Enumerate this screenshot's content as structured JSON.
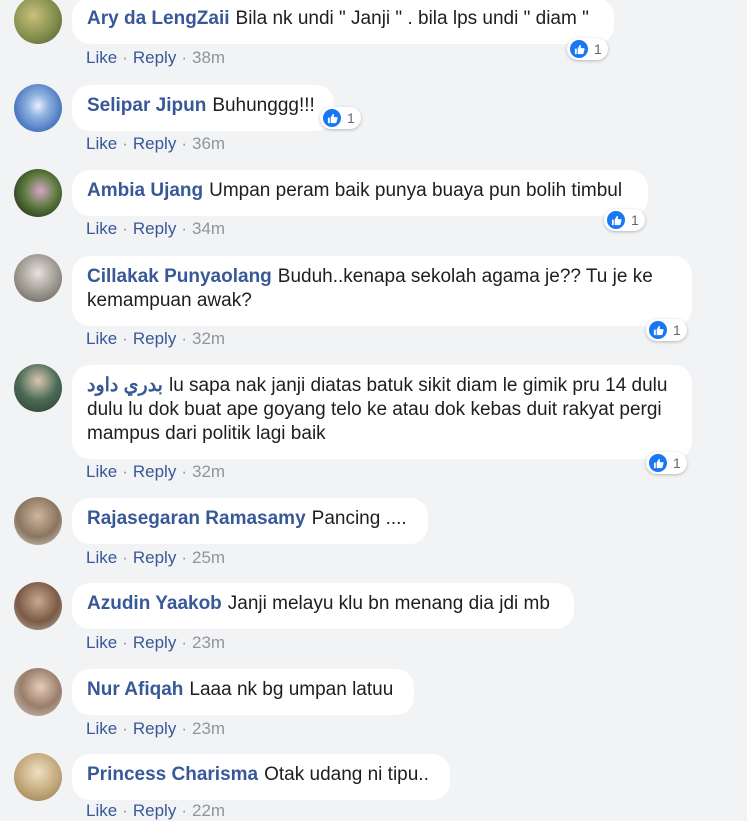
{
  "comments": [
    {
      "author": "Ary da LengZaii",
      "text": "Bila nk undi \" Janji \" . bila lps undi \" diam \"",
      "like": "Like",
      "reply": "Reply",
      "time": "38m",
      "reactions": "1"
    },
    {
      "author": "Selipar Jipun",
      "text": "Buhunggg!!!",
      "like": "Like",
      "reply": "Reply",
      "time": "36m",
      "reactions": "1"
    },
    {
      "author": "Ambia Ujang",
      "text": "Umpan peram baik punya buaya pun bolih timbul",
      "like": "Like",
      "reply": "Reply",
      "time": "34m",
      "reactions": "1"
    },
    {
      "author": "Cillakak Punyaolang",
      "text": "Buduh..kenapa sekolah agama je?? Tu je ke kemampuan awak?",
      "like": "Like",
      "reply": "Reply",
      "time": "32m",
      "reactions": "1"
    },
    {
      "author": "بدري داود",
      "text": "lu sapa nak janji diatas batuk sikit diam le gimik pru 14 dulu dulu lu dok buat ape goyang telo ke atau dok kebas duit rakyat pergi mampus dari politik lagi baik",
      "like": "Like",
      "reply": "Reply",
      "time": "32m",
      "reactions": "1"
    },
    {
      "author": "Rajasegaran Ramasamy",
      "text": "Pancing ....",
      "like": "Like",
      "reply": "Reply",
      "time": "25m"
    },
    {
      "author": "Azudin Yaakob",
      "text": "Janji melayu klu bn menang dia jdi mb",
      "like": "Like",
      "reply": "Reply",
      "time": "23m"
    },
    {
      "author": "Nur Afiqah",
      "text": "Laaa nk bg umpan latuu",
      "like": "Like",
      "reply": "Reply",
      "time": "23m"
    },
    {
      "author": "Princess Charisma",
      "text": "Otak udang ni tipu..",
      "like": "Like",
      "reply": "Reply",
      "time": "22m"
    }
  ],
  "separator": "·"
}
